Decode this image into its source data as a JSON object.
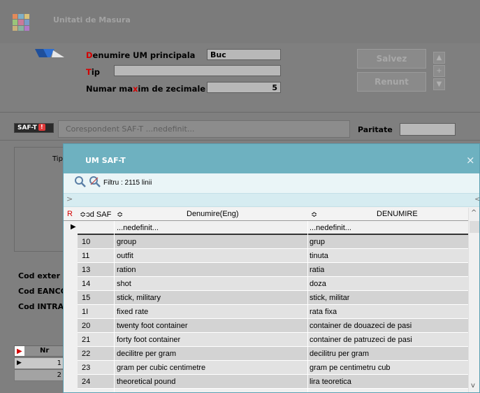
{
  "window": {
    "title": "Unitati de Masura"
  },
  "form": {
    "uom_label_first": "D",
    "uom_label_rest": "enumire UM principala",
    "uom_value": "Buc",
    "tip_label_first": "T",
    "tip_label_rest": "ip",
    "tip_value": "",
    "dec_label_a": "Numar ma",
    "dec_label_x": "x",
    "dec_label_b": "im de zecimale",
    "dec_value": "5"
  },
  "buttons": {
    "save": "Salvez",
    "cancel": "Renunt",
    "up": "▲",
    "plus": "+",
    "down": "▼"
  },
  "saft": {
    "badge_text": "SAF-T",
    "badge_mark": "!",
    "coresp_text": "Corespondent SAF-T   ...nedefinit...",
    "paritate_label": "Paritate",
    "paritate_value": ""
  },
  "side": {
    "tip_label": "Tip",
    "cod_extern": "Cod exter",
    "cod_eanc": "Cod EANCC",
    "cod_intra": "Cod INTRA"
  },
  "small_grid": {
    "header": "Nr",
    "rows": [
      "1",
      "2"
    ]
  },
  "modal": {
    "title": "UM SAF-T",
    "close": "×",
    "filter_text": "Filtru : 2115 linii",
    "strip_left": ">",
    "strip_right": "<",
    "columns": {
      "r": "R",
      "code": "≎ɔd SAF",
      "eng": "Denumire(Eng)",
      "eng_sort": "≎",
      "ro_sort": "≎",
      "ro": "DENUMIRE"
    },
    "rows": [
      {
        "code": "",
        "eng": "...nedefinit...",
        "ro": "...nedefinit..."
      },
      {
        "code": "10",
        "eng": "group",
        "ro": "grup"
      },
      {
        "code": "11",
        "eng": "outfit",
        "ro": "tinuta"
      },
      {
        "code": "13",
        "eng": "ration",
        "ro": "ratia"
      },
      {
        "code": "14",
        "eng": "shot",
        "ro": "doza"
      },
      {
        "code": "15",
        "eng": "stick, military",
        "ro": "stick, militar"
      },
      {
        "code": "1I",
        "eng": "fixed rate",
        "ro": "rata fixa"
      },
      {
        "code": "20",
        "eng": "twenty foot container",
        "ro": "container de douazeci de pasi"
      },
      {
        "code": "21",
        "eng": "forty foot container",
        "ro": "container de patruzeci de pasi"
      },
      {
        "code": "22",
        "eng": "decilitre per gram",
        "ro": "decilitru per gram"
      },
      {
        "code": "23",
        "eng": "gram per cubic centimetre",
        "ro": "gram pe centimetru cub"
      },
      {
        "code": "24",
        "eng": "theoretical pound",
        "ro": "lira teoretica"
      }
    ],
    "scroll_up": "^",
    "scroll_down": "v"
  },
  "colors": {
    "modal_title_bar": "#6eb1c0",
    "row_dark": "#d3d3d3",
    "row_light": "#e2e2e2",
    "required_red": "#d40000"
  }
}
